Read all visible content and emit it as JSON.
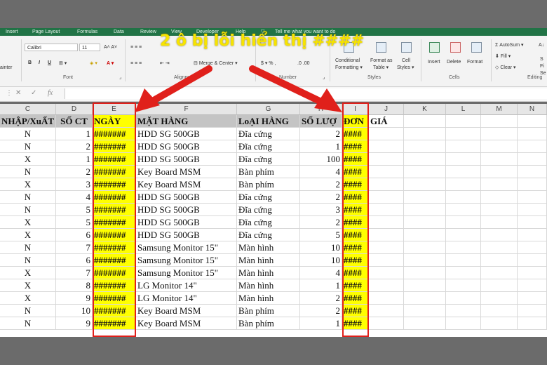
{
  "tabs": [
    "Insert",
    "Page Layout",
    "Formulas",
    "Data",
    "Review",
    "View",
    "Developer",
    "Help",
    "Tell me what you want to do"
  ],
  "ribbon": {
    "font_name": "Calibri",
    "font_size": "11",
    "left_label": "ainter",
    "font_group": "Font",
    "alignment_group": "Alignment",
    "merge_center": "Merge & Center",
    "number_group": "Number",
    "conditional_formatting": "Conditional",
    "conditional_formatting_2": "Formatting ▾",
    "format_as_table": "Format as",
    "format_as_table_2": "Table ▾",
    "cell_styles": "Cell",
    "cell_styles_2": "Styles ▾",
    "styles_group": "Styles",
    "insert": "Insert",
    "delete": "Delete",
    "format": "Format",
    "cells_group": "Cells",
    "autosum": "AutoSum ▾",
    "fill": "Fill ▾",
    "clear": "Clear ▾",
    "editing_group": "Editing",
    "sort_s": "S",
    "sort_fi": "Fi",
    "sort_se": "Se"
  },
  "formula_bar": {
    "cancel": "✕",
    "enter": "✓",
    "fx": "fx"
  },
  "annotation": "2 ô bị lỗi hiển thị ####",
  "columns": [
    "C",
    "D",
    "E",
    "F",
    "G",
    "H",
    "I",
    "J",
    "K",
    "L",
    "M",
    "N"
  ],
  "header_row": {
    "c": "NHẬP/XuẤT",
    "d": "SỐ CT",
    "e": "NGÀY",
    "f": "MẶT HÀNG",
    "g": "LoẠI HÀNG",
    "h": "SỐ LƯỢ",
    "i": "ĐƠN",
    "j": "GIÁ"
  },
  "rows": [
    {
      "c": "N",
      "d": "1",
      "e": "#######",
      "f": "HDD SG 500GB",
      "g": "Đĩa cứng",
      "h": "2",
      "i": "####"
    },
    {
      "c": "N",
      "d": "2",
      "e": "#######",
      "f": "HDD SG 500GB",
      "g": "Đĩa cứng",
      "h": "1",
      "i": "####"
    },
    {
      "c": "X",
      "d": "1",
      "e": "#######",
      "f": "HDD SG 500GB",
      "g": "Đĩa cứng",
      "h": "100",
      "i": "####"
    },
    {
      "c": "N",
      "d": "2",
      "e": "#######",
      "f": "Key Board MSM",
      "g": "Bàn phím",
      "h": "4",
      "i": "####"
    },
    {
      "c": "X",
      "d": "3",
      "e": "#######",
      "f": "Key Board MSM",
      "g": "Bàn phím",
      "h": "2",
      "i": "####"
    },
    {
      "c": "N",
      "d": "4",
      "e": "#######",
      "f": "HDD SG 500GB",
      "g": "Đĩa cứng",
      "h": "2",
      "i": "####"
    },
    {
      "c": "N",
      "d": "5",
      "e": "#######",
      "f": "HDD SG 500GB",
      "g": "Đĩa cứng",
      "h": "3",
      "i": "####"
    },
    {
      "c": "X",
      "d": "5",
      "e": "#######",
      "f": "HDD SG 500GB",
      "g": "Đĩa cứng",
      "h": "2",
      "i": "####"
    },
    {
      "c": "X",
      "d": "6",
      "e": "#######",
      "f": "HDD SG 500GB",
      "g": "Đĩa cứng",
      "h": "5",
      "i": "####"
    },
    {
      "c": "N",
      "d": "7",
      "e": "#######",
      "f": "Samsung Monitor 15\"",
      "g": "Màn hình",
      "h": "10",
      "i": "####"
    },
    {
      "c": "N",
      "d": "6",
      "e": "#######",
      "f": "Samsung Monitor 15\"",
      "g": "Màn hình",
      "h": "10",
      "i": "####"
    },
    {
      "c": "X",
      "d": "7",
      "e": "#######",
      "f": "Samsung Monitor 15\"",
      "g": "Màn hình",
      "h": "4",
      "i": "####"
    },
    {
      "c": "X",
      "d": "8",
      "e": "#######",
      "f": "LG Monitor 14\"",
      "g": "Màn hình",
      "h": "1",
      "i": "####"
    },
    {
      "c": "X",
      "d": "9",
      "e": "#######",
      "f": "LG Monitor 14\"",
      "g": "Màn hình",
      "h": "2",
      "i": "####"
    },
    {
      "c": "N",
      "d": "10",
      "e": "#######",
      "f": "Key Board MSM",
      "g": "Bàn phím",
      "h": "2",
      "i": "####"
    },
    {
      "c": "N",
      "d": "9",
      "e": "#######",
      "f": "Key Board MSM",
      "g": "Bàn phím",
      "h": "1",
      "i": "####"
    }
  ],
  "colors": {
    "ribbon_green": "#217346",
    "highlight": "#ffff00",
    "annotation": "#f7e400",
    "arrow": "#e0201b"
  }
}
